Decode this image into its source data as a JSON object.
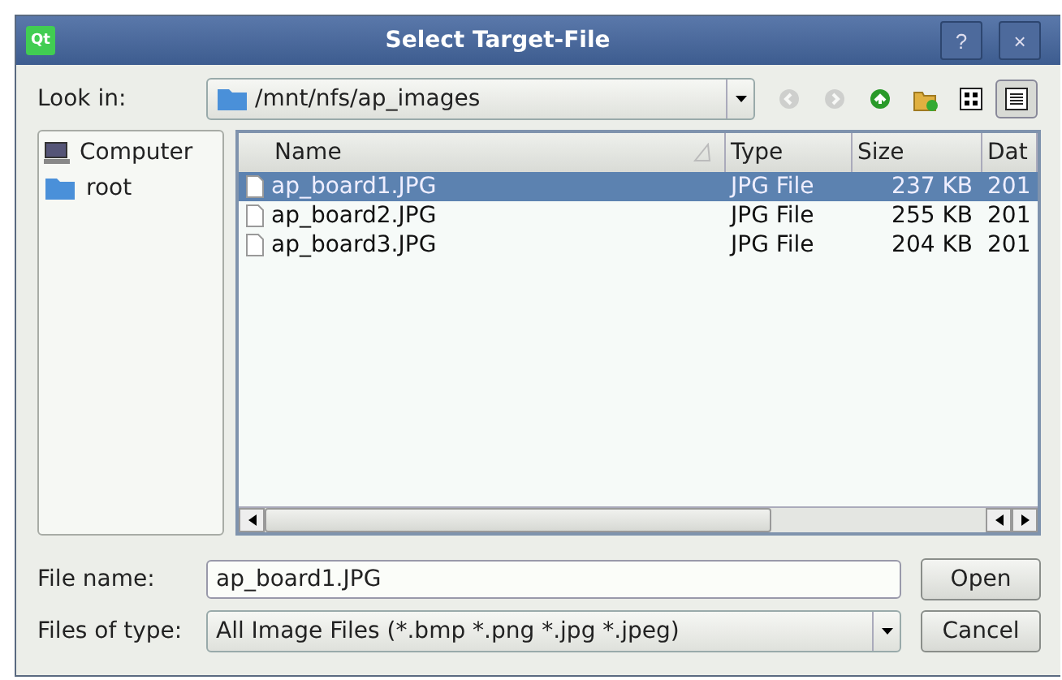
{
  "window": {
    "logo": "Qt",
    "title": "Select Target-File",
    "help": "?",
    "close": "×"
  },
  "look_in": {
    "label": "Look in:",
    "path": "/mnt/nfs/ap_images"
  },
  "toolbar": [
    {
      "kind": "back",
      "disabled": true
    },
    {
      "kind": "forward",
      "disabled": true
    },
    {
      "kind": "up",
      "disabled": false
    },
    {
      "kind": "new-folder",
      "disabled": false
    },
    {
      "kind": "icon-view",
      "selected": false
    },
    {
      "kind": "detail-view",
      "selected": true
    }
  ],
  "sidebar": {
    "items": [
      {
        "label": "Computer",
        "kind": "computer"
      },
      {
        "label": "root",
        "kind": "folder"
      }
    ]
  },
  "table": {
    "columns": [
      "Name",
      "Type",
      "Size",
      "Dat"
    ],
    "rows": [
      {
        "cells": [
          "ap_board1.JPG",
          "JPG File",
          "237 KB",
          "201"
        ],
        "selected": true
      },
      {
        "cells": [
          "ap_board2.JPG",
          "JPG File",
          "255 KB",
          "201"
        ],
        "selected": false
      },
      {
        "cells": [
          "ap_board3.JPG",
          "JPG File",
          "204 KB",
          "201"
        ],
        "selected": false
      }
    ]
  },
  "file_name": {
    "label": "File name:",
    "value": "ap_board1.JPG"
  },
  "file_type": {
    "label": "Files of type:",
    "value": "All Image Files (*.bmp *.png *.jpg *.jpeg)"
  },
  "buttons": [
    "Open",
    "Cancel"
  ]
}
